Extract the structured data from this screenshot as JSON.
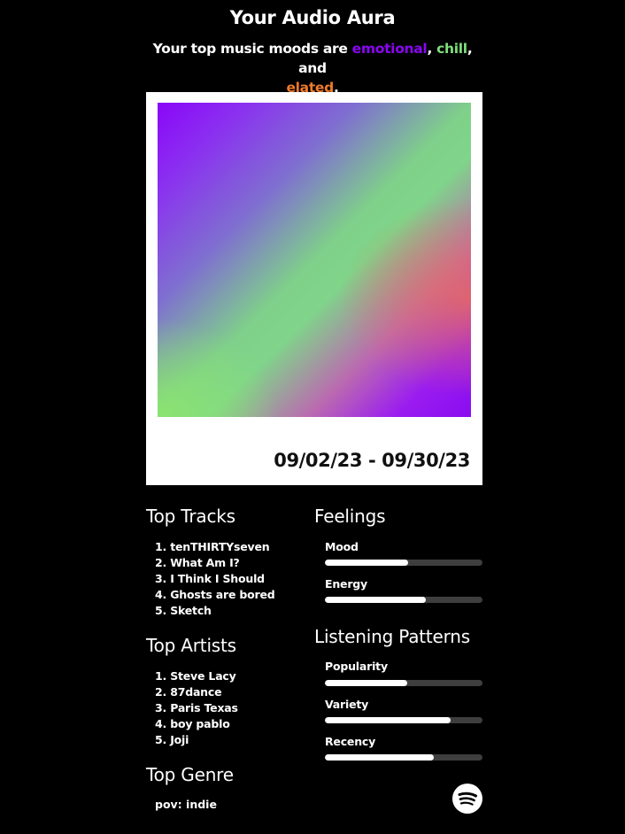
{
  "title": "Your Audio Aura",
  "subtitle": {
    "prefix": "Your top music moods are ",
    "mood1": "emotional",
    "sep1": ", ",
    "mood2": "chill",
    "sep2": ", and ",
    "mood3": "elated",
    "suffix": "."
  },
  "colors": {
    "mood1": "#8a06f2",
    "mood2": "#7ee07a",
    "mood3": "#f07a2a"
  },
  "date_range": "09/02/23 - 09/30/23",
  "top_tracks": {
    "heading": "Top Tracks",
    "items": [
      "1. tenTHIRTYseven",
      "2. What Am I?",
      "3. I Think I Should",
      "4. Ghosts are bored",
      "5. Sketch"
    ]
  },
  "top_artists": {
    "heading": "Top Artists",
    "items": [
      "1. Steve Lacy",
      "2. 87dance",
      "3. Paris Texas",
      "4. boy pablo",
      "5. Joji"
    ]
  },
  "top_genre": {
    "heading": "Top Genre",
    "value": "pov: indie"
  },
  "feelings": {
    "heading": "Feelings",
    "meters": [
      {
        "label": "Mood",
        "fraction": 0.53
      },
      {
        "label": "Energy",
        "fraction": 0.64
      }
    ]
  },
  "listening_patterns": {
    "heading": "Listening Patterns",
    "meters": [
      {
        "label": "Popularity",
        "fraction": 0.52
      },
      {
        "label": "Variety",
        "fraction": 0.8
      },
      {
        "label": "Recency",
        "fraction": 0.69
      }
    ]
  },
  "icons": {
    "brand": "spotify-icon"
  }
}
